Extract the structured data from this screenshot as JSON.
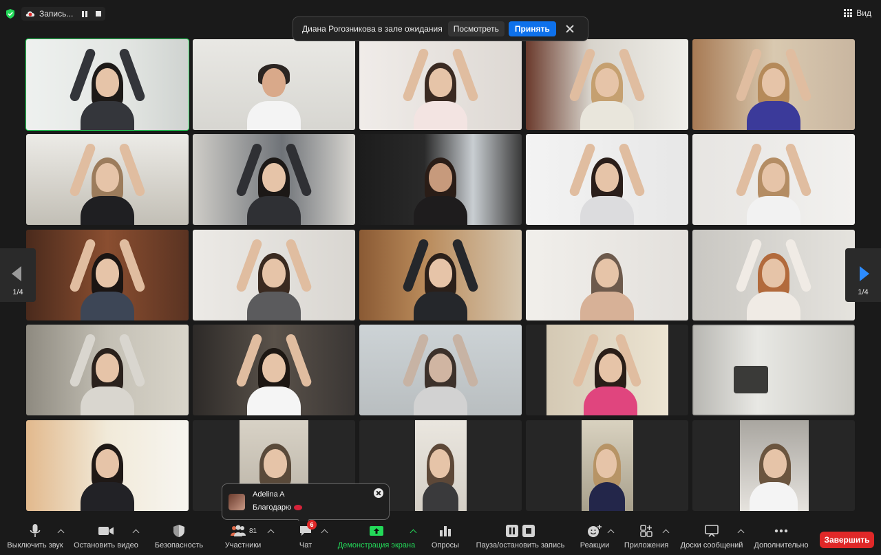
{
  "topbar": {
    "recording_label": "Запись...",
    "view_label": "Вид"
  },
  "notice": {
    "text": "Диана Рогозникова в зале ожидания",
    "view_button": "Посмотреть",
    "accept_button": "Принять"
  },
  "pager": {
    "left": "1/4",
    "right": "1/4"
  },
  "chat_toast": {
    "sender": "Adelina A",
    "message": "Благодарю"
  },
  "toolbar": {
    "mute": "Выключить звук",
    "stop_video": "Остановить видео",
    "security": "Безопасность",
    "participants": "Участники",
    "participants_count": "81",
    "chat": "Чат",
    "chat_badge": "6",
    "share_screen": "Демонстрация экрана",
    "polls": "Опросы",
    "recording": "Пауза/остановить запись",
    "reactions": "Реакции",
    "apps": "Приложения",
    "whiteboards": "Доски сообщений",
    "more": "Дополнительно",
    "end": "Завершить"
  },
  "colors": {
    "accent_blue": "#0e71eb",
    "active_speaker": "#23d959",
    "end_red": "#e02828"
  }
}
